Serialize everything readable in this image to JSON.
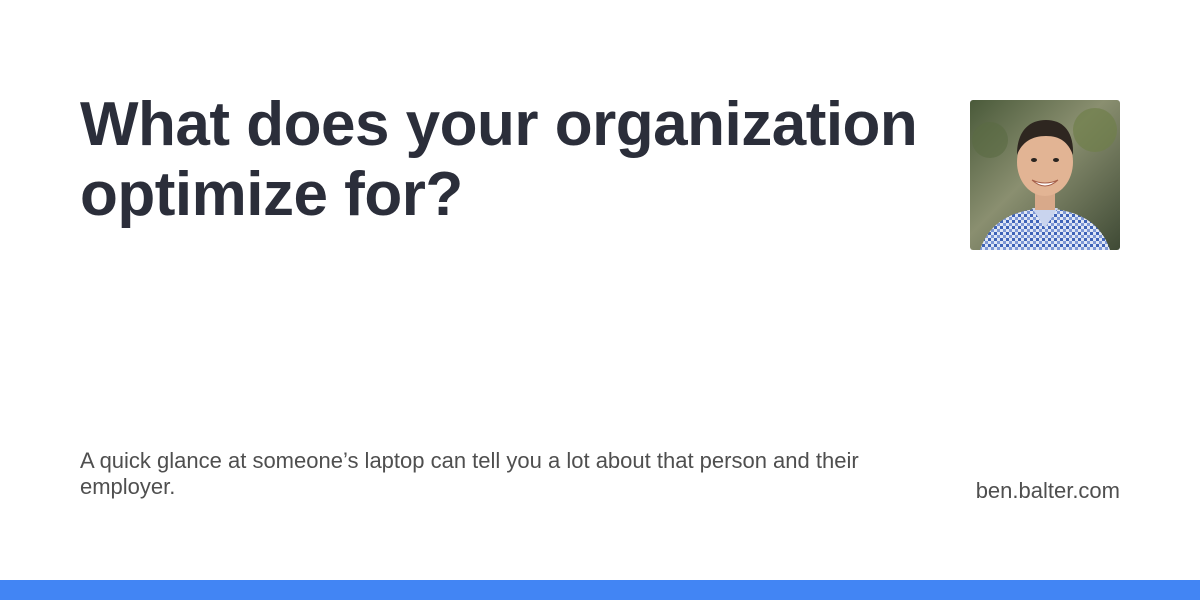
{
  "title": "What does your organization optimize for?",
  "description": "A quick glance at someone’s laptop can tell you a lot about that person and their employer.",
  "site": "ben.balter.com",
  "avatar_icon": "author-photo",
  "colors": {
    "title": "#2b2e3a",
    "body_text": "#4f4f4f",
    "accent_bar": "#4285f4",
    "background": "#ffffff"
  }
}
